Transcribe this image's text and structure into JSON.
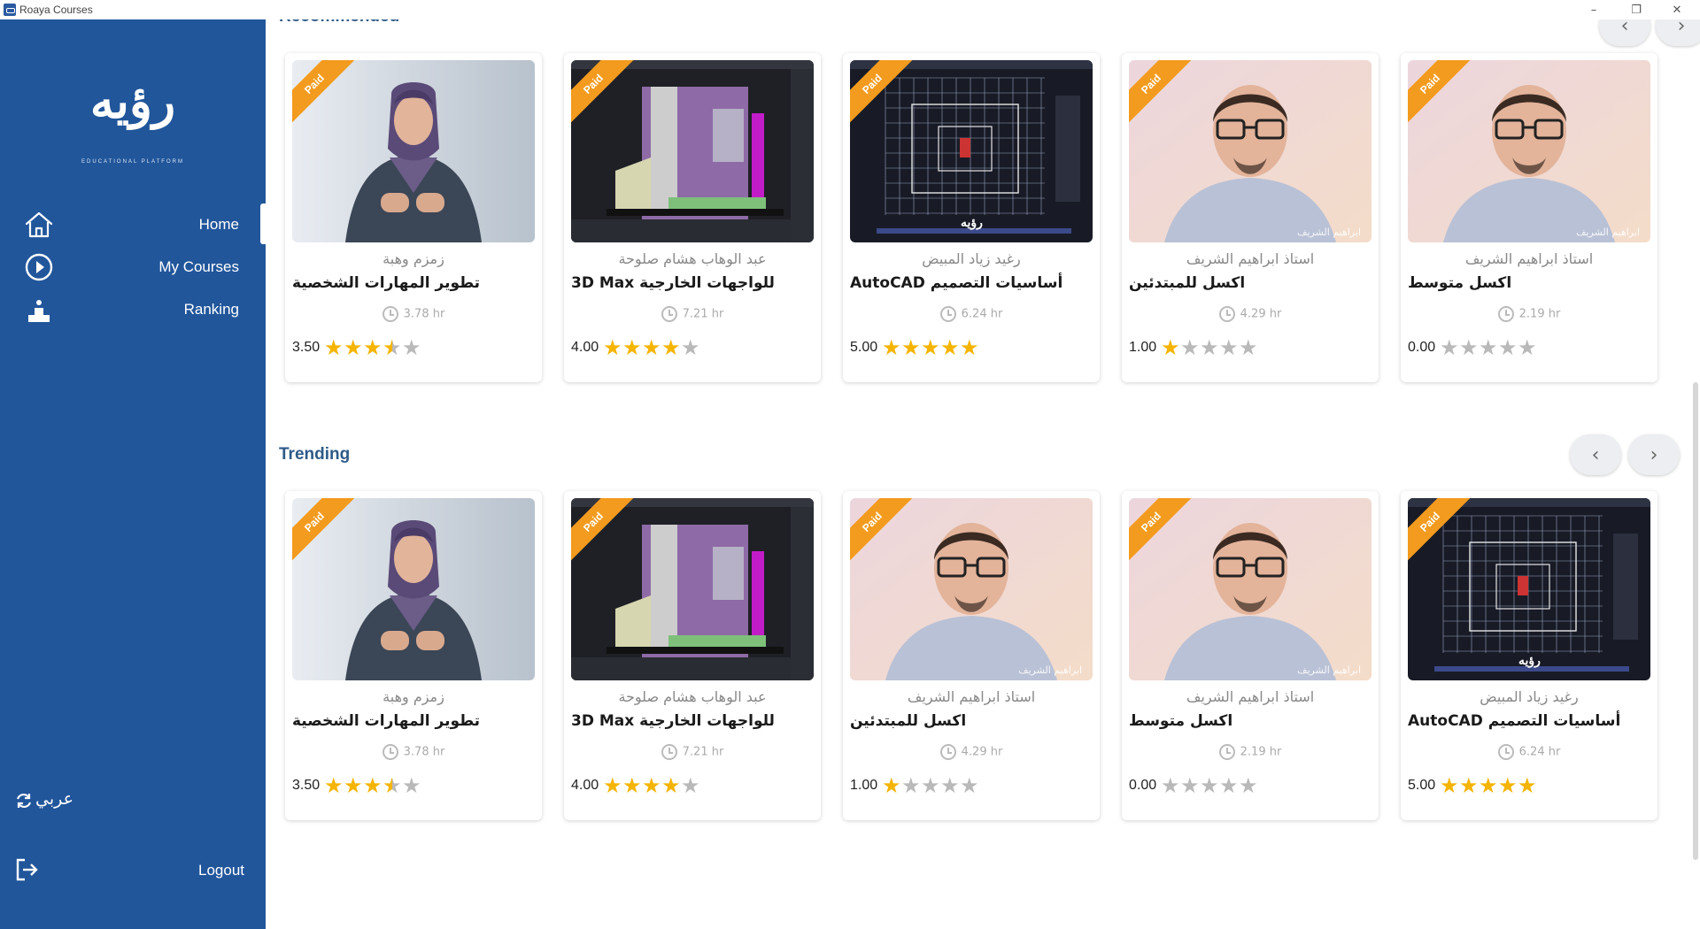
{
  "window": {
    "title": "Roaya Courses"
  },
  "sidebar": {
    "logo_text": "رؤيه",
    "logo_subtitle": "EDUCATIONAL PLATFORM",
    "items": [
      {
        "label": "Home",
        "icon": "home-icon"
      },
      {
        "label": "My Courses",
        "icon": "play-circle-icon"
      },
      {
        "label": "Ranking",
        "icon": "podium-icon"
      }
    ],
    "language_label": "عربي",
    "logout_label": "Logout"
  },
  "sections": {
    "recommended": {
      "title": "Recommended",
      "cards": [
        {
          "badge": "Paid",
          "instructor": "زمزم وهبة",
          "title": "تطوير المهارات الشخصية",
          "duration": "3.78 hr",
          "rating_text": "3.50",
          "rating": 3.5,
          "thumb": "woman-speaker"
        },
        {
          "badge": "Paid",
          "instructor": "عبد الوهاب هشام صلوحة",
          "title": "3D Max للواجهات الخارجية",
          "duration": "7.21 hr",
          "rating_text": "4.00",
          "rating": 4,
          "thumb": "3d-model"
        },
        {
          "badge": "Paid",
          "instructor": "رغيد زياد المبيض",
          "title": "AutoCAD أساسيات التصميم",
          "duration": "6.24 hr",
          "rating_text": "5.00",
          "rating": 5,
          "thumb": "cad-plan"
        },
        {
          "badge": "Paid",
          "instructor": "استاذ ابراهيم الشريف",
          "title": "اكسل للمبتدئين",
          "duration": "4.29 hr",
          "rating_text": "1.00",
          "rating": 1,
          "thumb": "man-glasses"
        },
        {
          "badge": "Paid",
          "instructor": "استاذ ابراهيم الشريف",
          "title": "اكسل متوسط",
          "duration": "2.19 hr",
          "rating_text": "0.00",
          "rating": 0,
          "thumb": "man-glasses"
        }
      ]
    },
    "trending": {
      "title": "Trending",
      "cards": [
        {
          "badge": "Paid",
          "instructor": "زمزم وهبة",
          "title": "تطوير المهارات الشخصية",
          "duration": "3.78 hr",
          "rating_text": "3.50",
          "rating": 3.5,
          "thumb": "woman-speaker"
        },
        {
          "badge": "Paid",
          "instructor": "عبد الوهاب هشام صلوحة",
          "title": "3D Max للواجهات الخارجية",
          "duration": "7.21 hr",
          "rating_text": "4.00",
          "rating": 4,
          "thumb": "3d-model"
        },
        {
          "badge": "Paid",
          "instructor": "استاذ ابراهيم الشريف",
          "title": "اكسل للمبتدئين",
          "duration": "4.29 hr",
          "rating_text": "1.00",
          "rating": 1,
          "thumb": "man-glasses"
        },
        {
          "badge": "Paid",
          "instructor": "استاذ ابراهيم الشريف",
          "title": "اكسل متوسط",
          "duration": "2.19 hr",
          "rating_text": "0.00",
          "rating": 0,
          "thumb": "man-glasses"
        },
        {
          "badge": "Paid",
          "instructor": "رغيد زياد المبيض",
          "title": "AutoCAD أساسيات التصميم",
          "duration": "6.24 hr",
          "rating_text": "5.00",
          "rating": 5,
          "thumb": "cad-plan"
        }
      ]
    }
  },
  "thumb_watermark": "ابراهيم الشريف",
  "cad_watermark": "رؤيه",
  "colors": {
    "sidebar": "#21569B",
    "accent": "#2E5A88",
    "badge": "#F39B1E",
    "star": "#F5B400"
  }
}
